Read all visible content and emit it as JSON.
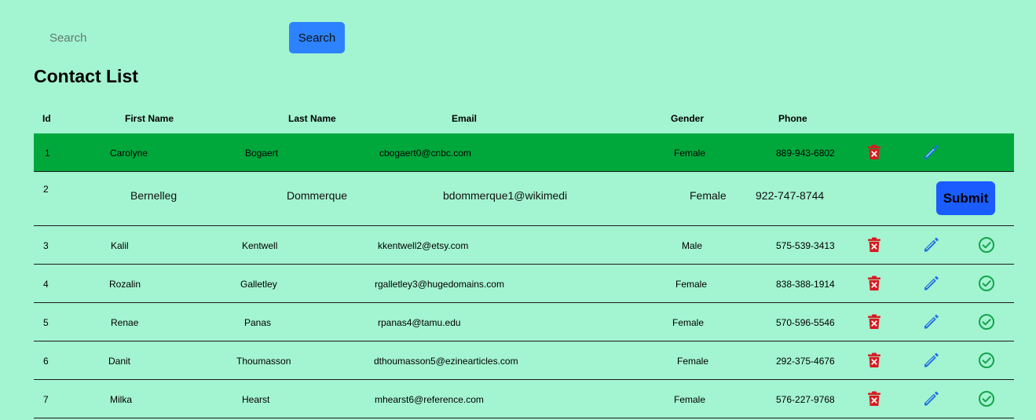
{
  "search": {
    "placeholder": "Search",
    "value": "",
    "button_label": "Search"
  },
  "title": "Contact List",
  "columns": [
    "Id",
    "First Name",
    "Last Name",
    "Email",
    "Gender",
    "Phone"
  ],
  "rows": [
    {
      "id": "1",
      "first": "Carolyne",
      "last": "Bogaert",
      "email": "cbogaert0@cnbc.com",
      "gender": "Female",
      "phone": "889-943-6802",
      "selected": true
    },
    {
      "id": "2",
      "first": "Bernelleg",
      "last": "Dommerque",
      "email": "bdommerque1@wikimedi",
      "gender": "Female",
      "phone": "922-747-8744",
      "editing": true
    },
    {
      "id": "3",
      "first": "Kalil",
      "last": "Kentwell",
      "email": "kkentwell2@etsy.com",
      "gender": "Male",
      "phone": "575-539-3413"
    },
    {
      "id": "4",
      "first": "Rozalin",
      "last": "Galletley",
      "email": "rgalletley3@hugedomains.com",
      "gender": "Female",
      "phone": "838-388-1914"
    },
    {
      "id": "5",
      "first": "Renae",
      "last": "Panas",
      "email": "rpanas4@tamu.edu",
      "gender": "Female",
      "phone": "570-596-5546"
    },
    {
      "id": "6",
      "first": "Danit",
      "last": "Thoumasson",
      "email": "dthoumasson5@ezinearticles.com",
      "gender": "Female",
      "phone": "292-375-4676"
    },
    {
      "id": "7",
      "first": "Milka",
      "last": "Hearst",
      "email": "mhearst6@reference.com",
      "gender": "Female",
      "phone": "576-227-9768"
    }
  ],
  "submit_label": "Submit",
  "icons": {
    "delete": "trash-icon",
    "edit": "pencil-icon",
    "confirm": "check-circle-icon"
  },
  "colors": {
    "background": "#a3f4d1",
    "selected_row": "#00a83c",
    "delete": "#d9191f",
    "edit": "#1f6fe0",
    "confirm": "#16a34a",
    "submit": "#1b5cff"
  }
}
